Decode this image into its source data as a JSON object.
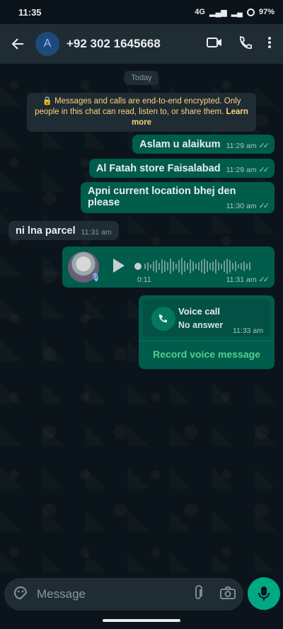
{
  "statusbar": {
    "time": "11:35",
    "network": "4G",
    "battery": "97%"
  },
  "header": {
    "avatar_letter": "A",
    "contact": "+92 302 1645668"
  },
  "chat": {
    "day": "Today",
    "encryption_text": "Messages and calls are end-to-end encrypted. Only people in this chat can read, listen to, or share them.",
    "encryption_link": "Learn more",
    "messages": [
      {
        "text": "Aslam u alaikum",
        "time": "11:29 am"
      },
      {
        "text": "Al Fatah store Faisalabad",
        "time": "11:29 am"
      },
      {
        "text": "Apni current location bhej den please",
        "time": "11:30 am"
      },
      {
        "text": "ni lna parcel",
        "time": "11:31 am"
      }
    ],
    "voice": {
      "duration": "0:11",
      "time": "11:31 am"
    },
    "call": {
      "title": "Voice call",
      "status": "No answer",
      "time": "11:33 am",
      "action": "Record voice message"
    }
  },
  "composer": {
    "placeholder": "Message"
  },
  "colors": {
    "accent": "#00a884",
    "outgoing_bubble": "#005c4b",
    "incoming_bubble": "#1f2c34"
  }
}
